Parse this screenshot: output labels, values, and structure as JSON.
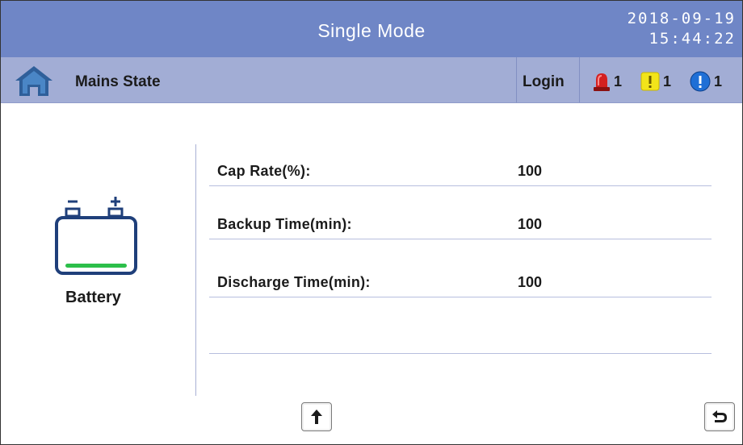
{
  "header": {
    "title": "Single Mode",
    "date": "2018-09-19",
    "time": "15:44:22"
  },
  "status_bar": {
    "home_icon": "home-icon",
    "section": "Mains State",
    "login_label": "Login",
    "alarms": [
      {
        "icon": "siren-icon",
        "count": "1",
        "color": "#d42020"
      },
      {
        "icon": "warning-icon",
        "count": "1",
        "color": "#f2e41a"
      },
      {
        "icon": "info-icon",
        "count": "1",
        "color": "#1f6fd6"
      }
    ]
  },
  "battery": {
    "icon": "battery-icon",
    "label": "Battery",
    "charge_bar_color": "#2cbf4a"
  },
  "readings": [
    {
      "label": "Cap Rate(%):",
      "value": "100"
    },
    {
      "label": "Backup Time(min):",
      "value": "100"
    },
    {
      "label": "Discharge Time(min):",
      "value": "100"
    }
  ],
  "controls": {
    "page_up_icon": "arrow-up-icon",
    "back_icon": "return-arrow-icon"
  },
  "colors": {
    "title_bar": "#6f86c6",
    "status_bar": "#a2add5",
    "home_icon": "#2f5f9a"
  }
}
